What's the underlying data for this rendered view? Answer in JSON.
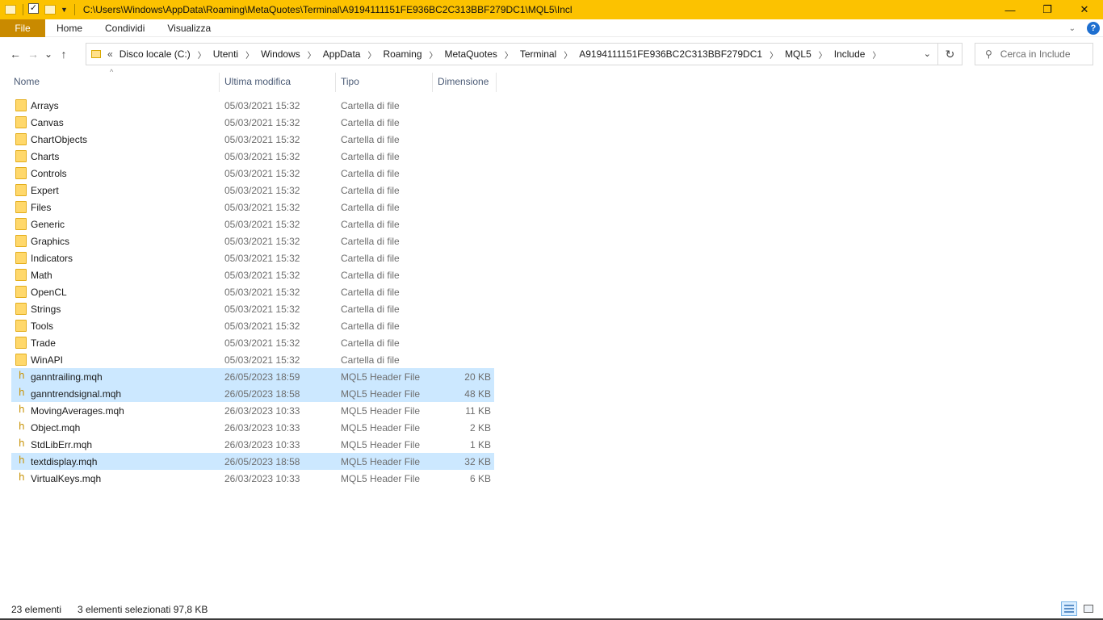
{
  "window": {
    "title": "C:\\Users\\Windows\\AppData\\Roaming\\MetaQuotes\\Terminal\\A9194111151FE936BC2C313BBF279DC1\\MQL5\\Incl",
    "minimize": "—",
    "maximize": "❐",
    "close": "✕"
  },
  "ribbon": {
    "tabs": [
      "File",
      "Home",
      "Condividi",
      "Visualizza"
    ],
    "help": "?"
  },
  "nav": {
    "back": "←",
    "forward": "→",
    "recent": "⌄",
    "up": "↑",
    "overflow": "«",
    "breadcrumbs": [
      "Disco locale (C:)",
      "Utenti",
      "Windows",
      "AppData",
      "Roaming",
      "MetaQuotes",
      "Terminal",
      "A9194111151FE936BC2C313BBF279DC1",
      "MQL5",
      "Include"
    ],
    "search_placeholder": "Cerca in Include"
  },
  "columns": {
    "name": "Nome",
    "modified": "Ultima modifica",
    "type": "Tipo",
    "size": "Dimensione"
  },
  "files": [
    {
      "name": "Arrays",
      "date": "05/03/2021 15:32",
      "type": "Cartella di file",
      "size": "",
      "kind": "folder",
      "selected": false
    },
    {
      "name": "Canvas",
      "date": "05/03/2021 15:32",
      "type": "Cartella di file",
      "size": "",
      "kind": "folder",
      "selected": false
    },
    {
      "name": "ChartObjects",
      "date": "05/03/2021 15:32",
      "type": "Cartella di file",
      "size": "",
      "kind": "folder",
      "selected": false
    },
    {
      "name": "Charts",
      "date": "05/03/2021 15:32",
      "type": "Cartella di file",
      "size": "",
      "kind": "folder",
      "selected": false
    },
    {
      "name": "Controls",
      "date": "05/03/2021 15:32",
      "type": "Cartella di file",
      "size": "",
      "kind": "folder",
      "selected": false
    },
    {
      "name": "Expert",
      "date": "05/03/2021 15:32",
      "type": "Cartella di file",
      "size": "",
      "kind": "folder",
      "selected": false
    },
    {
      "name": "Files",
      "date": "05/03/2021 15:32",
      "type": "Cartella di file",
      "size": "",
      "kind": "folder",
      "selected": false
    },
    {
      "name": "Generic",
      "date": "05/03/2021 15:32",
      "type": "Cartella di file",
      "size": "",
      "kind": "folder",
      "selected": false
    },
    {
      "name": "Graphics",
      "date": "05/03/2021 15:32",
      "type": "Cartella di file",
      "size": "",
      "kind": "folder",
      "selected": false
    },
    {
      "name": "Indicators",
      "date": "05/03/2021 15:32",
      "type": "Cartella di file",
      "size": "",
      "kind": "folder",
      "selected": false
    },
    {
      "name": "Math",
      "date": "05/03/2021 15:32",
      "type": "Cartella di file",
      "size": "",
      "kind": "folder",
      "selected": false
    },
    {
      "name": "OpenCL",
      "date": "05/03/2021 15:32",
      "type": "Cartella di file",
      "size": "",
      "kind": "folder",
      "selected": false
    },
    {
      "name": "Strings",
      "date": "05/03/2021 15:32",
      "type": "Cartella di file",
      "size": "",
      "kind": "folder",
      "selected": false
    },
    {
      "name": "Tools",
      "date": "05/03/2021 15:32",
      "type": "Cartella di file",
      "size": "",
      "kind": "folder",
      "selected": false
    },
    {
      "name": "Trade",
      "date": "05/03/2021 15:32",
      "type": "Cartella di file",
      "size": "",
      "kind": "folder",
      "selected": false
    },
    {
      "name": "WinAPI",
      "date": "05/03/2021 15:32",
      "type": "Cartella di file",
      "size": "",
      "kind": "folder",
      "selected": false
    },
    {
      "name": "ganntrailing.mqh",
      "date": "26/05/2023 18:59",
      "type": "MQL5 Header File",
      "size": "20 KB",
      "kind": "header",
      "selected": true
    },
    {
      "name": "ganntrendsignal.mqh",
      "date": "26/05/2023 18:58",
      "type": "MQL5 Header File",
      "size": "48 KB",
      "kind": "header",
      "selected": true
    },
    {
      "name": "MovingAverages.mqh",
      "date": "26/03/2023 10:33",
      "type": "MQL5 Header File",
      "size": "11 KB",
      "kind": "header",
      "selected": false
    },
    {
      "name": "Object.mqh",
      "date": "26/03/2023 10:33",
      "type": "MQL5 Header File",
      "size": "2 KB",
      "kind": "header",
      "selected": false
    },
    {
      "name": "StdLibErr.mqh",
      "date": "26/03/2023 10:33",
      "type": "MQL5 Header File",
      "size": "1 KB",
      "kind": "header",
      "selected": false
    },
    {
      "name": "textdisplay.mqh",
      "date": "26/05/2023 18:58",
      "type": "MQL5 Header File",
      "size": "32 KB",
      "kind": "header",
      "selected": true
    },
    {
      "name": "VirtualKeys.mqh",
      "date": "26/03/2023 10:33",
      "type": "MQL5 Header File",
      "size": "6 KB",
      "kind": "header",
      "selected": false
    }
  ],
  "status": {
    "count": "23 elementi",
    "selection": "3 elementi selezionati  97,8 KB"
  },
  "colors": {
    "titlebar": "#fcc200",
    "file_tab": "#c98a00",
    "selection": "#cce8ff",
    "folder": "#ffd86b"
  }
}
